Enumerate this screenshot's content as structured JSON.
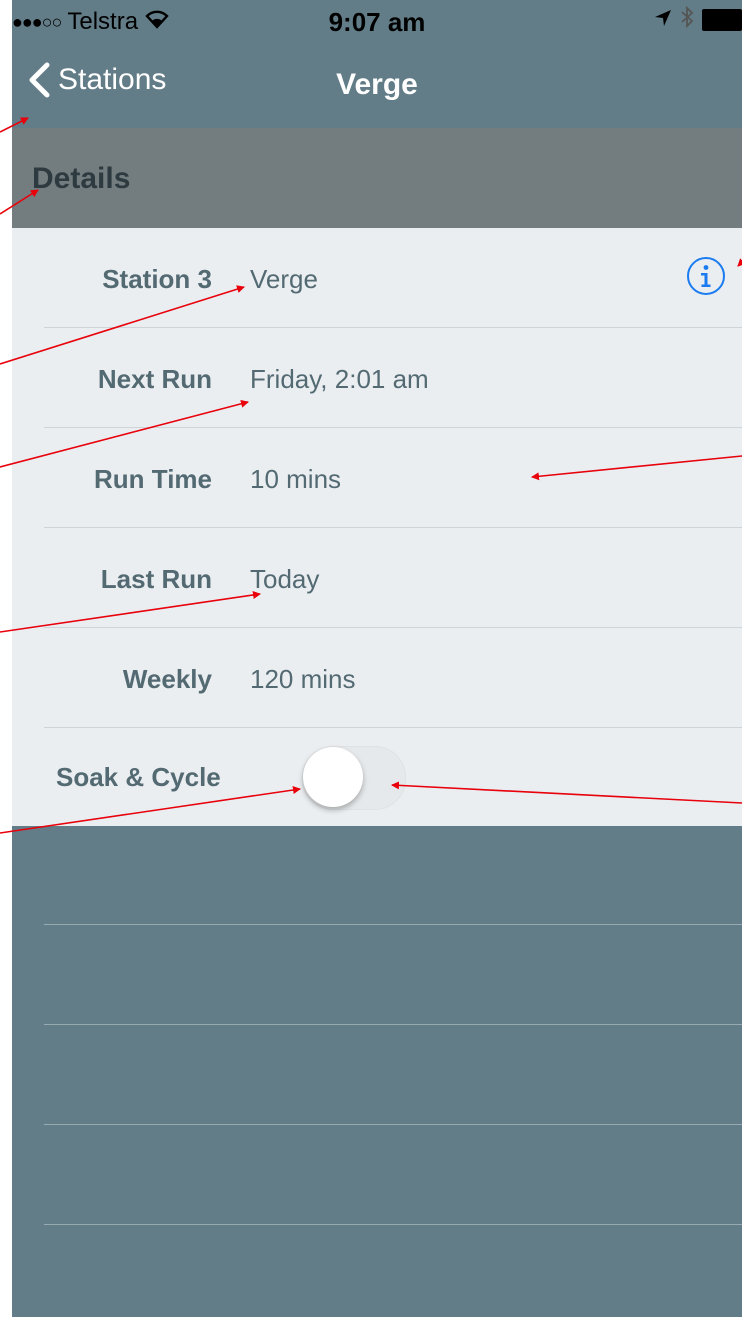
{
  "status_bar": {
    "carrier": "Telstra",
    "signal_dots": "●●●○○",
    "time": "9:07 am",
    "icons": [
      "signal-dots-icon",
      "wifi-icon",
      "location-arrow-icon",
      "bluetooth-icon",
      "battery-icon"
    ]
  },
  "nav": {
    "back_label": "Stations",
    "title": "Verge"
  },
  "section": {
    "title": "Details"
  },
  "details": [
    {
      "label": "Station 3",
      "value": "Verge"
    },
    {
      "label": "Next Run",
      "value": "Friday, 2:01 am"
    },
    {
      "label": "Run Time",
      "value": "10 mins"
    },
    {
      "label": "Last Run",
      "value": "Today"
    },
    {
      "label": "Weekly",
      "value": "120 mins"
    }
  ],
  "soak_cycle": {
    "label": "Soak & Cycle",
    "enabled": false
  },
  "colors": {
    "background": "#627d87",
    "section_header": "#737d7f",
    "list_background": "#ebeef1",
    "text": "#536a73",
    "info_accent": "#1a7cf0",
    "annotation_arrow": "#e8000b"
  }
}
